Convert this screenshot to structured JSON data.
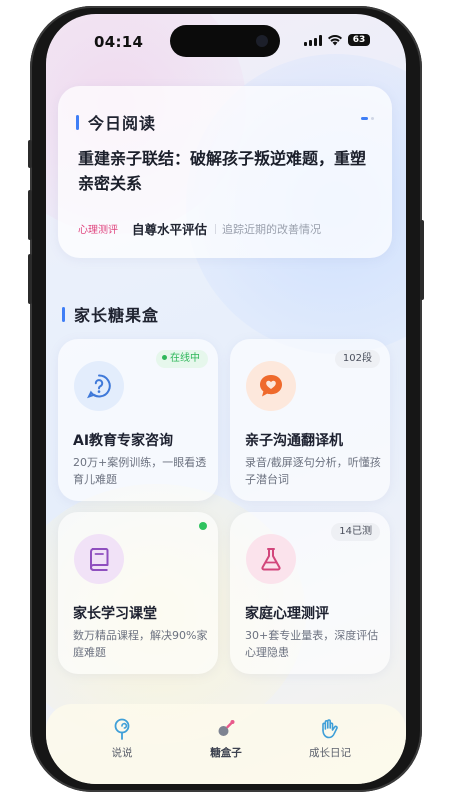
{
  "status_bar": {
    "time": "04:14",
    "battery": "63"
  },
  "today_reading": {
    "title": "今日阅读",
    "headline": "重建亲子联结：破解孩子叛逆难题，重塑亲密关系",
    "tag": "心理测评",
    "tag_title": "自尊水平评估",
    "tag_subtitle": "追踪近期的改善情况"
  },
  "candy_box": {
    "title": "家长糖果盒",
    "tiles": [
      {
        "title": "AI教育专家咨询",
        "desc": "20万+案例训练，一眼看透育儿难题",
        "badge": "在线中",
        "icon": "question-icon"
      },
      {
        "title": "亲子沟通翻译机",
        "desc": "录音/截屏逐句分析，听懂孩子潜台词",
        "badge": "102段",
        "icon": "heart-chat-icon"
      },
      {
        "title": "家长学习课堂",
        "desc": "数万精品课程，解决90%家庭难题",
        "badge": "",
        "icon": "book-icon"
      },
      {
        "title": "家庭心理测评",
        "desc": "30+套专业量表，深度评估心理隐患",
        "badge": "14已测",
        "icon": "flask-icon"
      }
    ]
  },
  "bottom_nav": {
    "items": [
      {
        "label": "说说",
        "icon": "lollipop-icon"
      },
      {
        "label": "糖盒子",
        "icon": "candy-box-icon"
      },
      {
        "label": "成长日记",
        "icon": "hands-icon"
      }
    ],
    "active": "糖盒子"
  },
  "colors": {
    "accent": "#3f7ef6",
    "tag_pink": "#e0457f",
    "online_green": "#2fb75a",
    "icon_blue": "#3f79d9",
    "icon_orange": "#ef6a2c",
    "icon_purple": "#8f4fbf",
    "icon_pink": "#d2467b"
  }
}
